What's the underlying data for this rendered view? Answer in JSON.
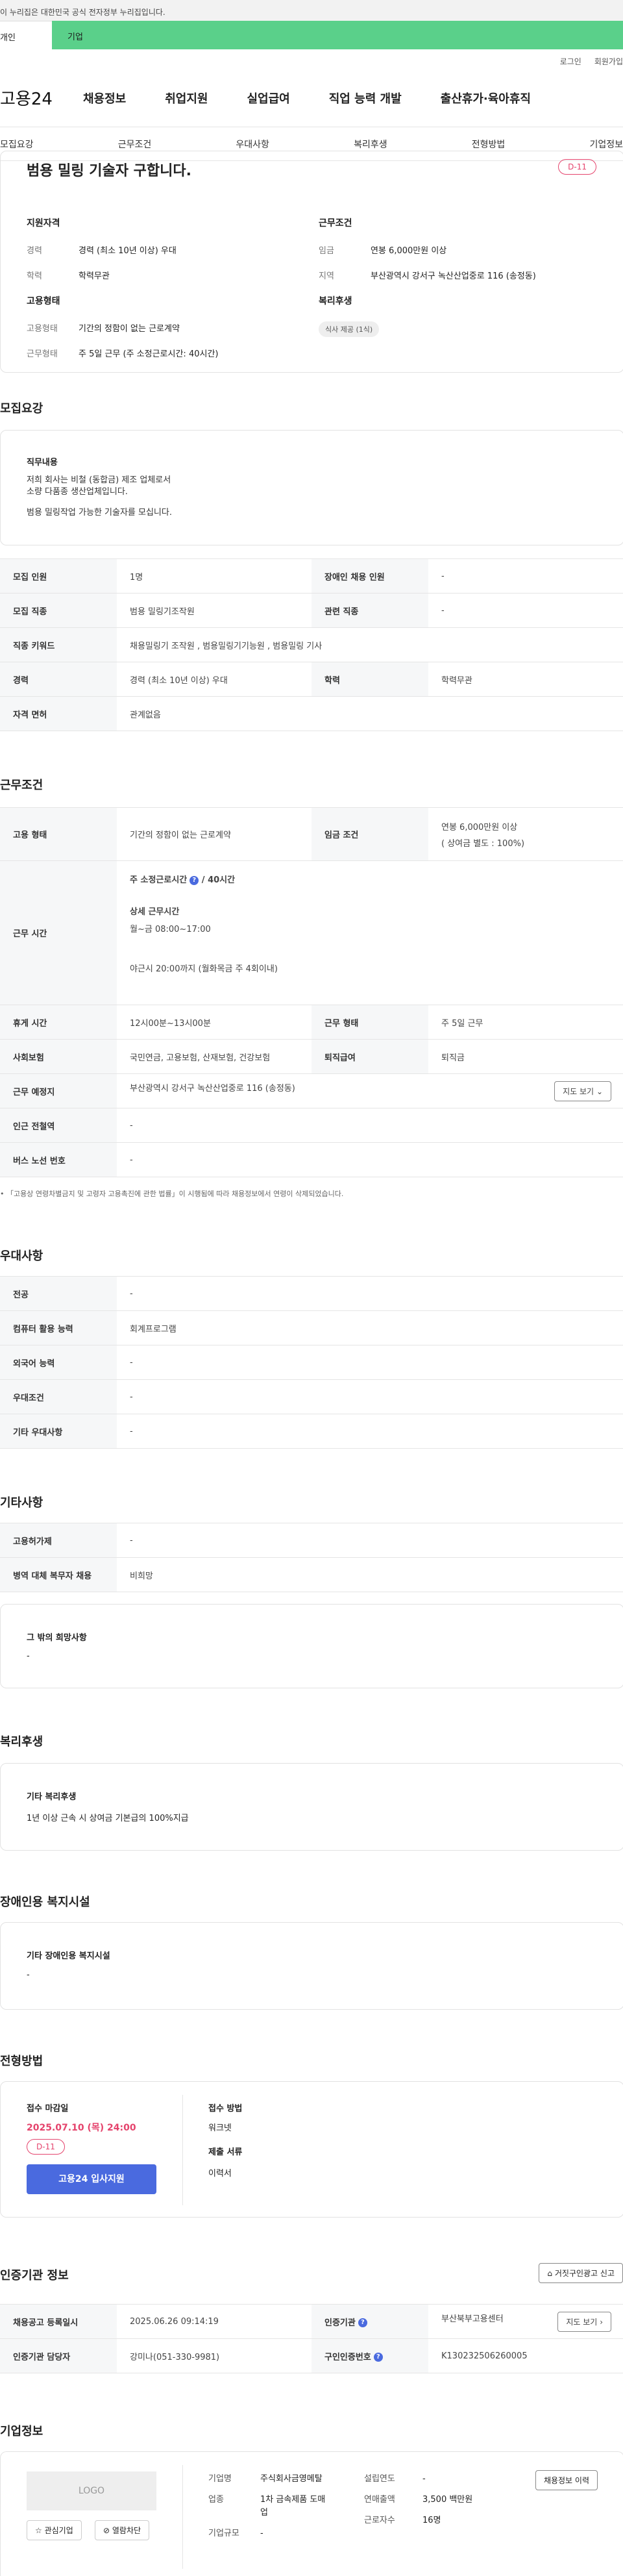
{
  "gov_banner": "이 누리집은 대한민국 공식 전자정부 누리집입니다.",
  "top_tabs": [
    "개인",
    "기업"
  ],
  "util": [
    "로그인",
    "회원가입"
  ],
  "gnb": {
    "logo": "고용24",
    "menu": [
      "채용정보",
      "취업지원",
      "실업급여",
      "직업 능력 개발",
      "출산휴가·육아휴직"
    ]
  },
  "subnav": [
    "모집요강",
    "근무조건",
    "우대사항",
    "복리후생",
    "전형방법",
    "기업정보"
  ],
  "job": {
    "title": "범용 밀링 기술자 구합니다.",
    "dday": "D-11",
    "qual": {
      "title": "지원자격",
      "rows": [
        [
          "경력",
          "경력 (최소 10년 이상) 우대"
        ],
        [
          "학력",
          "학력무관"
        ]
      ]
    },
    "cond": {
      "title": "근무조건",
      "rows": [
        [
          "임금",
          "연봉 6,000만원 이상"
        ],
        [
          "지역",
          "부산광역시 강서구 녹산산업중로 116 (송정동)"
        ]
      ]
    },
    "emp": {
      "title": "고용형태",
      "rows": [
        [
          "고용형태",
          "기간의 정함이 없는 근로계약"
        ],
        [
          "근무형태",
          "주 5일 근무 (주 소정근로시간: 40시간)"
        ]
      ]
    },
    "welfare": {
      "title": "복리후생",
      "badge": "식사 제공 (1식)"
    }
  },
  "recruit": {
    "title": "모집요강",
    "duty_title": "직무내용",
    "duty_lines": [
      "저희 회사는 비철 (동합금) 제조 업체로서",
      "소량 다품종 생산업체입니다.",
      "범용 밀링작업  가능한  기술자를 모십니다."
    ],
    "rows": [
      [
        "모집 인원",
        "1명",
        "장애인 채용 인원",
        "-"
      ],
      [
        "모집 직종",
        "범용 밀링기조작원",
        "관련 직종",
        "-"
      ],
      [
        "직종 키워드",
        "채용밀링기 조작원 , 범용밀링기기능원 , 범용밀링 기사",
        "",
        ""
      ],
      [
        "경력",
        "경력 (최소 10년 이상) 우대",
        "학력",
        "학력무관"
      ],
      [
        "자격 면허",
        "관계없음",
        "",
        ""
      ]
    ]
  },
  "work": {
    "title": "근무조건",
    "emp_type": [
      "고용 형태",
      "기간의 정함이 없는 근로계약",
      "임금 조건",
      "연봉 6,000만원 이상",
      "( 상여금 별도 : 100%)"
    ],
    "hours": {
      "label": "근무 시간",
      "weekly": "주 소정근로시간",
      "weekly_val": "40시간",
      "detail_title": "상세 근무시간",
      "detail": "월~금 08:00~17:00",
      "night": "야근시 20:00까지 (월화목금 주 4회이내)"
    },
    "rows": [
      [
        "휴게 시간",
        "12시00분~13시00분",
        "근무 형태",
        "주 5일 근무"
      ],
      [
        "사회보험",
        "국민연금, 고용보험, 산재보험, 건강보험",
        "퇴직급여",
        "퇴직금"
      ]
    ],
    "place": [
      "근무 예정지",
      "부산광역시 강서구 녹산산업중로 116 (송정동)",
      "지도 보기"
    ],
    "station": [
      "인근 전철역",
      "-"
    ],
    "bus": [
      "버스 노선 번호",
      "-"
    ],
    "note": "「고용상 연령차별금지 및 고령자 고용촉진에 관한 법률」이 시행됨에 따라 채용정보에서 연령이 삭제되었습니다."
  },
  "pref": {
    "title": "우대사항",
    "rows": [
      [
        "전공",
        "-"
      ],
      [
        "컴퓨터 활용 능력",
        "회계프로그램"
      ],
      [
        "외국어 능력",
        "-"
      ],
      [
        "우대조건",
        "-"
      ],
      [
        "기타 우대사항",
        "-"
      ]
    ]
  },
  "etc": {
    "title": "기타사항",
    "rows": [
      [
        "고용허가제",
        "-"
      ],
      [
        "병역 대체 복무자 채용",
        "비희망"
      ]
    ],
    "wish_title": "그 밖의 희망사항",
    "wish": "-"
  },
  "benefit": {
    "title": "복리후생",
    "sub": "기타 복리후생",
    "text": "1년 이상 근속 시 상여금  기본급의 100%지급"
  },
  "disabled": {
    "title": "장애인용 복지시설",
    "sub": "기타 장애인용 복지시설",
    "text": "-"
  },
  "screening": {
    "title": "전형방법",
    "deadline_label": "접수 마감일",
    "deadline": "2025.07.10 (목) 24:00",
    "dday": "D-11",
    "apply_btn": "고용24 입사지원",
    "method_label": "접수 방법",
    "method": "워크넷",
    "docs_label": "제출 서류",
    "docs": "이력서"
  },
  "agency": {
    "title": "인증기관 정보",
    "report_btn": "거짓구인광고 신고",
    "rows": [
      [
        "채용공고 등록일시",
        "2025.06.26 09:14:19",
        "인증기관",
        "부산북부고용센터"
      ],
      [
        "인증기관 담당자",
        "강미나(051-330-9981)",
        "구인인증번호",
        "K130232506260005"
      ]
    ],
    "map_btn": "지도 보기"
  },
  "company": {
    "title": "기업정보",
    "logo": "LOGO",
    "btns": [
      "관심기업",
      "열람차단"
    ],
    "more_btn": "채용정보 이력",
    "fields": [
      [
        "기업명",
        "주식회사금영메탈"
      ],
      [
        "업종",
        "1차 금속제품 도매업"
      ],
      [
        "기업규모",
        "-"
      ]
    ],
    "fields2": [
      [
        "설립연도",
        "-"
      ],
      [
        "연매출액",
        "3,500 백만원"
      ],
      [
        "근로자수",
        "16명"
      ]
    ]
  }
}
